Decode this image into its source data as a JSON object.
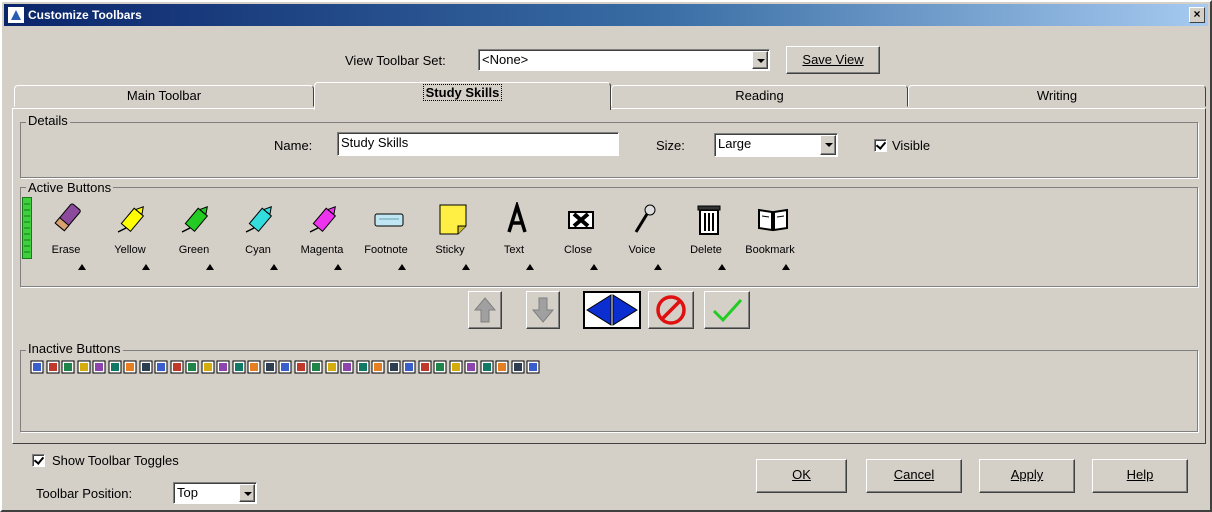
{
  "window": {
    "title": "Customize Toolbars",
    "close_glyph": "×"
  },
  "view_set": {
    "label": "View Toolbar Set:",
    "value": "<None>",
    "save_button": "Save View"
  },
  "tabs": [
    {
      "label": "Main Toolbar",
      "active": false
    },
    {
      "label": "Study Skills",
      "active": true
    },
    {
      "label": "Reading",
      "active": false
    },
    {
      "label": "Writing",
      "active": false
    }
  ],
  "details": {
    "title": "Details",
    "name_label": "Name:",
    "name_value": "Study Skills",
    "size_label": "Size:",
    "size_value": "Large",
    "visible_label": "Visible",
    "visible_checked": true
  },
  "active_buttons": {
    "title": "Active Buttons",
    "items": [
      {
        "label": "Erase",
        "icon": "eraser-icon",
        "color": "#8b4a9c"
      },
      {
        "label": "Yellow",
        "icon": "yellow-highlighter-icon",
        "color": "#ffff00"
      },
      {
        "label": "Green",
        "icon": "green-highlighter-icon",
        "color": "#22cc22"
      },
      {
        "label": "Cyan",
        "icon": "cyan-highlighter-icon",
        "color": "#33dddd"
      },
      {
        "label": "Magenta",
        "icon": "magenta-highlighter-icon",
        "color": "#ee33ee"
      },
      {
        "label": "Footnote",
        "icon": "footnote-icon",
        "color": "#bfe6f2"
      },
      {
        "label": "Sticky",
        "icon": "sticky-note-icon",
        "color": "#ffee44"
      },
      {
        "label": "Text",
        "icon": "text-icon",
        "color": "#000000"
      },
      {
        "label": "Close",
        "icon": "close-x-icon",
        "color": "#000000"
      },
      {
        "label": "Voice",
        "icon": "microphone-icon",
        "color": "#666666"
      },
      {
        "label": "Delete",
        "icon": "trash-icon",
        "color": "#333333"
      },
      {
        "label": "Bookmark",
        "icon": "book-icon",
        "color": "#333333"
      }
    ]
  },
  "move_controls": [
    {
      "name": "move-up-button",
      "icon": "arrow-up-icon"
    },
    {
      "name": "move-down-button",
      "icon": "arrow-down-icon"
    },
    {
      "name": "move-left-right-button",
      "icon": "left-right-arrow-icon"
    },
    {
      "name": "remove-button",
      "icon": "no-entry-icon"
    },
    {
      "name": "add-button",
      "icon": "checkmark-icon"
    }
  ],
  "inactive_buttons": {
    "title": "Inactive Buttons",
    "icons": [
      "new-doc-icon",
      "print-icon",
      "save-icon",
      "print-preview-icon",
      "open-icon",
      "rewind-icon",
      "play-icon",
      "fast-forward-icon",
      "volume-icon",
      "book-blue-icon",
      "book-red-icon",
      "reader-icon",
      "link-icon",
      "help-icon",
      "grid-icon",
      "table-icon",
      "spell-check-icon",
      "find-icon",
      "sort-icon",
      "zoom-icon",
      "globe-icon",
      "list-icon",
      "calculator-icon",
      "chart-icon",
      "picture-icon",
      "blank-box-icon",
      "color-picker-icon",
      "speech-bubble-icon",
      "pencil-icon",
      "pen-icon",
      "read-aloud-icon",
      "eye-icon",
      "rainbow-icon"
    ]
  },
  "footer": {
    "show_toggles_label": "Show Toolbar Toggles",
    "show_toggles_checked": true,
    "position_label": "Toolbar Position:",
    "position_value": "Top",
    "ok": "OK",
    "cancel": "Cancel",
    "apply": "Apply",
    "help": "Help"
  }
}
